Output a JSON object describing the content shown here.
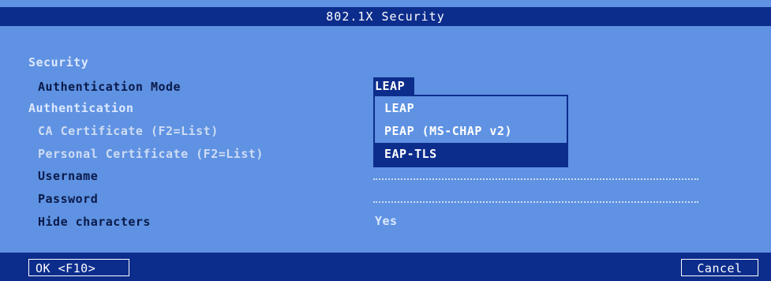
{
  "window": {
    "title": "802.1X Security"
  },
  "form": {
    "section_security": "Security",
    "auth_mode_label": "Authentication Mode",
    "auth_mode_value": "LEAP",
    "section_authentication": "Authentication",
    "ca_cert_label": "CA Certificate (F2=List)",
    "personal_cert_label": "Personal Certificate (F2=List)",
    "username_label": "Username",
    "password_label": "Password",
    "hide_chars_label": "Hide characters",
    "hide_chars_value": "Yes"
  },
  "dropdown": {
    "options": [
      "LEAP",
      "PEAP (MS-CHAP v2)",
      "EAP-TLS"
    ],
    "selected": "EAP-TLS"
  },
  "buttons": {
    "ok": "OK <F10>",
    "cancel": "Cancel"
  },
  "colors": {
    "background": "#5f92e2",
    "bar": "#0d2d8c",
    "text_dark": "#0a1a4a",
    "text_light": "#ffffff"
  }
}
